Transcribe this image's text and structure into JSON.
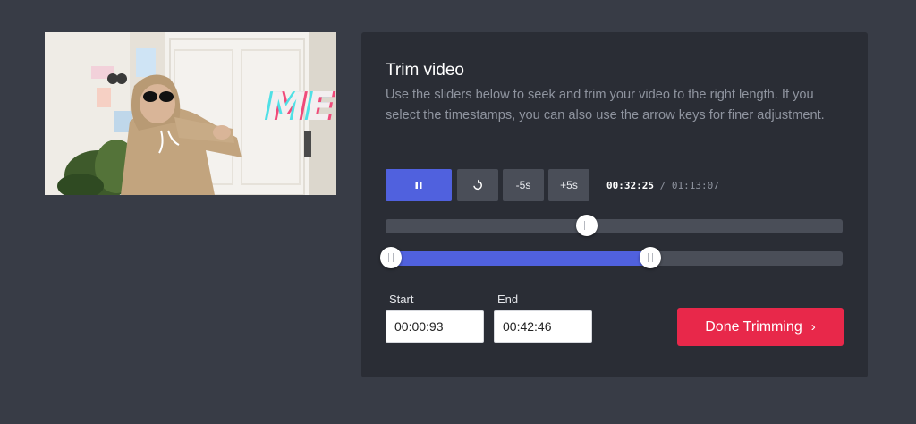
{
  "video": {
    "overlay_text": "ME"
  },
  "trim": {
    "title": "Trim video",
    "description": "Use the sliders below to seek and trim your video to the right length. If you select the timestamps, you can also use the arrow keys for finer adjustment.",
    "controls": {
      "play_pause_icon": "pause-icon",
      "restart_icon": "restart-icon",
      "back_label": "-5s",
      "forward_label": "+5s"
    },
    "time": {
      "current": "00:32:25",
      "separator": "/",
      "duration": "01:13:07"
    },
    "seek": {
      "position_fraction": 0.441
    },
    "range": {
      "start_fraction": 0.012,
      "end_fraction": 0.579
    },
    "start_label": "Start",
    "start_value": "00:00:93",
    "end_label": "End",
    "end_value": "00:42:46",
    "done_label": "Done Trimming",
    "done_icon": "chevron-right-icon",
    "colors": {
      "accent": "#5061de",
      "done": "#e8284a",
      "panel": "#2a2d35",
      "background": "#383c46"
    }
  }
}
